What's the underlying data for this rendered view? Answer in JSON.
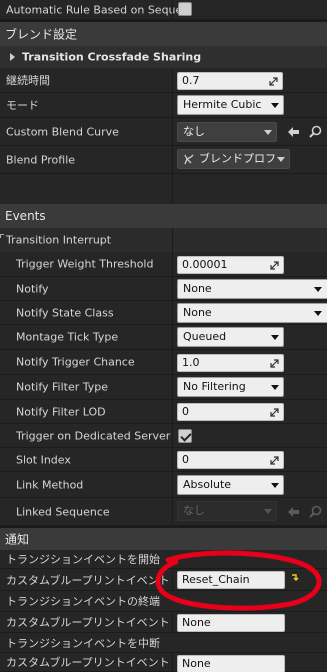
{
  "top_row": {
    "label": "Automatic Rule Based on Sequen"
  },
  "blend_section": {
    "title": "ブレンド設定",
    "subsection": "Transition Crossfade Sharing",
    "rows": {
      "duration": {
        "label": "継続時間",
        "value": "0.7"
      },
      "mode": {
        "label": "モード",
        "value": "Hermite Cubic"
      },
      "curve": {
        "label": "Custom Blend Curve",
        "value": "なし"
      },
      "profile": {
        "label": "Blend Profile",
        "value": "ブレンドプロフ"
      }
    }
  },
  "events_section": {
    "title": "Events",
    "subsection": "Transition Interrupt",
    "rows": {
      "trigger_weight": {
        "label": "Trigger Weight Threshold",
        "value": "0.00001"
      },
      "notify": {
        "label": "Notify",
        "value": "None"
      },
      "notify_state_class": {
        "label": "Notify State Class",
        "value": "None"
      },
      "montage_tick": {
        "label": "Montage Tick Type",
        "value": "Queued"
      },
      "trigger_chance": {
        "label": "Notify Trigger Chance",
        "value": "1.0"
      },
      "filter_type": {
        "label": "Notify Filter Type",
        "value": "No Filtering"
      },
      "filter_lod": {
        "label": "Notify Filter LOD",
        "value": "0"
      },
      "dedicated_server": {
        "label": "Trigger on Dedicated Server",
        "checked": true
      },
      "slot_index": {
        "label": "Slot Index",
        "value": "0"
      },
      "link_method": {
        "label": "Link Method",
        "value": "Absolute"
      },
      "linked_sequence": {
        "label": "Linked Sequence",
        "value": "なし"
      }
    }
  },
  "notify_section": {
    "title": "通知",
    "rows": {
      "start_event": {
        "label": "トランジションイベントを開始"
      },
      "start_custom": {
        "label": "カスタムブループリントイベント",
        "value": "Reset_Chain"
      },
      "end_event": {
        "label": "トランジションイベントの終端"
      },
      "end_custom": {
        "label": "カスタムブループリントイベント",
        "value": "None"
      },
      "interrupt_event": {
        "label": "トランジションイベントを中断"
      },
      "interrupt_custom": {
        "label": "カスタムブループリントイベント",
        "value": "None"
      }
    }
  },
  "annotation": {
    "color": "#e8001a"
  }
}
